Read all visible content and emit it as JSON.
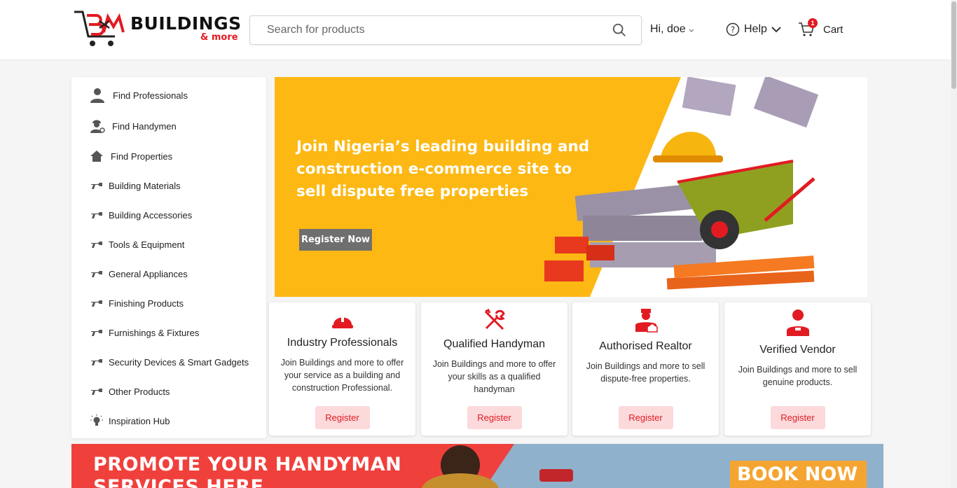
{
  "header": {
    "logo": {
      "wordmark": "BUILDINGS",
      "sub": "& more"
    },
    "search": {
      "placeholder": "Search for products"
    },
    "greeting": "Hi, doe",
    "help_label": "Help",
    "cart": {
      "label": "Cart",
      "count": "1"
    }
  },
  "sidebar": {
    "items": [
      {
        "label": "Find Professionals",
        "icon": "professional-icon"
      },
      {
        "label": "Find Handymen",
        "icon": "handyman-icon"
      },
      {
        "label": "Find Properties",
        "icon": "home-icon"
      },
      {
        "label": "Building Materials",
        "icon": "tool-icon"
      },
      {
        "label": "Building Accessories",
        "icon": "tool-icon"
      },
      {
        "label": "Tools & Equipment",
        "icon": "tool-icon"
      },
      {
        "label": "General Appliances",
        "icon": "tool-icon"
      },
      {
        "label": "Finishing Products",
        "icon": "tool-icon"
      },
      {
        "label": "Furnishings & Fixtures",
        "icon": "tool-icon"
      },
      {
        "label": "Security Devices & Smart Gadgets",
        "icon": "tool-icon"
      },
      {
        "label": "Other Products",
        "icon": "tool-icon"
      },
      {
        "label": "Inspiration Hub",
        "icon": "lightbulb-icon"
      }
    ]
  },
  "hero": {
    "headline": "Join Nigeria’s leading building and construction e-commerce site to sell dispute free properties",
    "button": "Register Now"
  },
  "cards": [
    {
      "title": "Industry Professionals",
      "desc": "Join Buildings and more to offer your service as a building and construction Professional.",
      "button": "Register",
      "icon": "hard-hat-icon"
    },
    {
      "title": "Qualified Handyman",
      "desc": "Join Buildings and more to offer your skills as a qualified handyman",
      "button": "Register",
      "icon": "tools-icon"
    },
    {
      "title": "Authorised Realtor",
      "desc": "Join Buildings and more to sell dispute-free properties.",
      "button": "Register",
      "icon": "realtor-icon"
    },
    {
      "title": "Verified Vendor",
      "desc": "Join Buildings and more to sell genuine products.",
      "button": "Register",
      "icon": "vendor-icon"
    }
  ],
  "promo": {
    "headline_line1": "PROMOTE YOUR HANDYMAN",
    "headline_line2": "SERVICES HERE",
    "cta": "BOOK NOW"
  },
  "colors": {
    "brand_red": "#e21b23",
    "hero_yellow": "#fdb813",
    "register_bg": "#fcd9db"
  }
}
